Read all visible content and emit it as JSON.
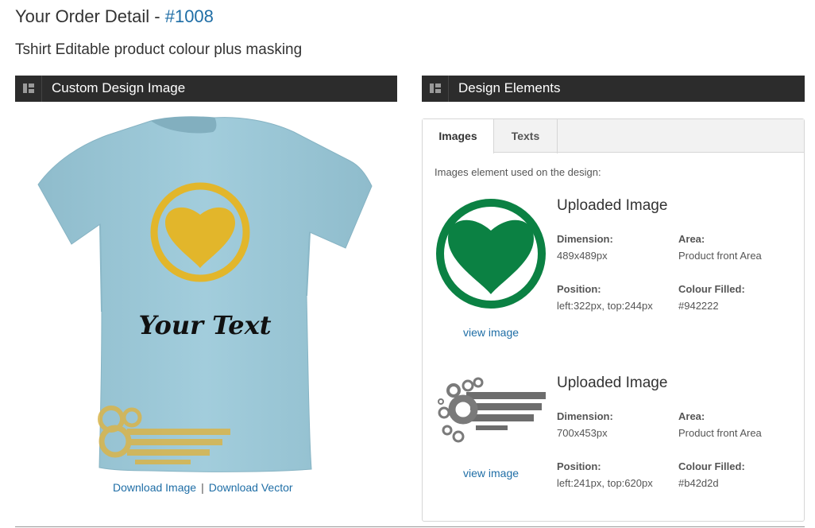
{
  "page": {
    "title_prefix": "Your Order Detail - ",
    "order_number": "#1008",
    "subtitle": "Tshirt Editable product colour plus masking"
  },
  "left_panel": {
    "header": "Custom Design Image",
    "shirt_text": "Your Text",
    "download_image": "Download Image",
    "separator": "|",
    "download_vector": "Download Vector"
  },
  "right_panel": {
    "header": "Design Elements",
    "tabs": [
      {
        "label": "Images",
        "active": true
      },
      {
        "label": "Texts",
        "active": false
      }
    ],
    "intro": "Images element used on the design:",
    "elements": [
      {
        "title": "Uploaded Image",
        "dimension_label": "Dimension:",
        "dimension": "489x489px",
        "area_label": "Area:",
        "area": "Product front Area",
        "position_label": "Position:",
        "position": "left:322px, top:244px",
        "colour_label": "Colour Filled:",
        "colour": "#942222",
        "view_link": "view image",
        "thumb_icon": "heart-circle-icon"
      },
      {
        "title": "Uploaded Image",
        "dimension_label": "Dimension:",
        "dimension": "700x453px",
        "area_label": "Area:",
        "area": "Product front Area",
        "position_label": "Position:",
        "position": "left:241px, top:620px",
        "colour_label": "Colour Filled:",
        "colour": "#b42d2d",
        "view_link": "view image",
        "thumb_icon": "grunge-stripes-icon"
      }
    ]
  },
  "colors": {
    "link": "#1f6ea6",
    "header_bg": "#2c2c2c",
    "shirt": "#9cc6d5",
    "print_yellow": "#e2b62b",
    "heart_green": "#0b8143"
  }
}
